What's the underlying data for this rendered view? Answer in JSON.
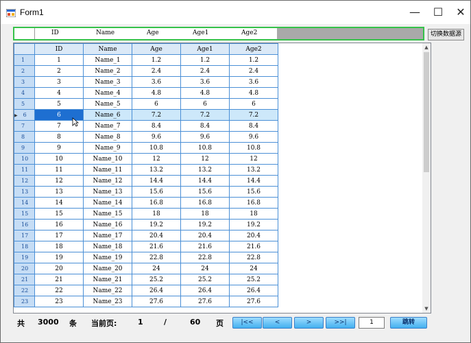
{
  "window": {
    "title": "Form1",
    "min_glyph": "—",
    "max_glyph": "☐",
    "close_glyph": "✕"
  },
  "header_strip": {
    "columns": [
      "ID",
      "Name",
      "Age",
      "Age1",
      "Age2"
    ]
  },
  "switch_button_label": "切换数据源",
  "grid": {
    "columns": [
      "ID",
      "Name",
      "Age",
      "Age1",
      "Age2"
    ],
    "current_row_indicator": "▶",
    "selected_row": 6,
    "rows": [
      {
        "n": "1",
        "id": "1",
        "name": "Name_1",
        "age": "1.2",
        "age1": "1.2",
        "age2": "1.2"
      },
      {
        "n": "2",
        "id": "2",
        "name": "Name_2",
        "age": "2.4",
        "age1": "2.4",
        "age2": "2.4"
      },
      {
        "n": "3",
        "id": "3",
        "name": "Name_3",
        "age": "3.6",
        "age1": "3.6",
        "age2": "3.6"
      },
      {
        "n": "4",
        "id": "4",
        "name": "Name_4",
        "age": "4.8",
        "age1": "4.8",
        "age2": "4.8"
      },
      {
        "n": "5",
        "id": "5",
        "name": "Name_5",
        "age": "6",
        "age1": "6",
        "age2": "6"
      },
      {
        "n": "6",
        "id": "6",
        "name": "Name_6",
        "age": "7.2",
        "age1": "7.2",
        "age2": "7.2"
      },
      {
        "n": "7",
        "id": "7",
        "name": "Name_7",
        "age": "8.4",
        "age1": "8.4",
        "age2": "8.4"
      },
      {
        "n": "8",
        "id": "8",
        "name": "Name_8",
        "age": "9.6",
        "age1": "9.6",
        "age2": "9.6"
      },
      {
        "n": "9",
        "id": "9",
        "name": "Name_9",
        "age": "10.8",
        "age1": "10.8",
        "age2": "10.8"
      },
      {
        "n": "10",
        "id": "10",
        "name": "Name_10",
        "age": "12",
        "age1": "12",
        "age2": "12"
      },
      {
        "n": "11",
        "id": "11",
        "name": "Name_11",
        "age": "13.2",
        "age1": "13.2",
        "age2": "13.2"
      },
      {
        "n": "12",
        "id": "12",
        "name": "Name_12",
        "age": "14.4",
        "age1": "14.4",
        "age2": "14.4"
      },
      {
        "n": "13",
        "id": "13",
        "name": "Name_13",
        "age": "15.6",
        "age1": "15.6",
        "age2": "15.6"
      },
      {
        "n": "14",
        "id": "14",
        "name": "Name_14",
        "age": "16.8",
        "age1": "16.8",
        "age2": "16.8"
      },
      {
        "n": "15",
        "id": "15",
        "name": "Name_15",
        "age": "18",
        "age1": "18",
        "age2": "18"
      },
      {
        "n": "16",
        "id": "16",
        "name": "Name_16",
        "age": "19.2",
        "age1": "19.2",
        "age2": "19.2"
      },
      {
        "n": "17",
        "id": "17",
        "name": "Name_17",
        "age": "20.4",
        "age1": "20.4",
        "age2": "20.4"
      },
      {
        "n": "18",
        "id": "18",
        "name": "Name_18",
        "age": "21.6",
        "age1": "21.6",
        "age2": "21.6"
      },
      {
        "n": "19",
        "id": "19",
        "name": "Name_19",
        "age": "22.8",
        "age1": "22.8",
        "age2": "22.8"
      },
      {
        "n": "20",
        "id": "20",
        "name": "Name_20",
        "age": "24",
        "age1": "24",
        "age2": "24"
      },
      {
        "n": "21",
        "id": "21",
        "name": "Name_21",
        "age": "25.2",
        "age1": "25.2",
        "age2": "25.2"
      },
      {
        "n": "22",
        "id": "22",
        "name": "Name_22",
        "age": "26.4",
        "age1": "26.4",
        "age2": "26.4"
      },
      {
        "n": "23",
        "id": "23",
        "name": "Name_23",
        "age": "27.6",
        "age1": "27.6",
        "age2": "27.6"
      }
    ],
    "scroll_up_glyph": "▲",
    "scroll_down_glyph": "▼"
  },
  "pager": {
    "total_prefix": "共",
    "total": "3000",
    "total_suffix": "条",
    "current_label": "当前页:",
    "current_page": "1",
    "divider": "/",
    "page_count": "60",
    "page_suffix": "页",
    "first_label": "|<<",
    "prev_label": "<",
    "next_label": ">",
    "last_label": ">>|",
    "page_input_value": "1",
    "jump_label": "跳转"
  }
}
